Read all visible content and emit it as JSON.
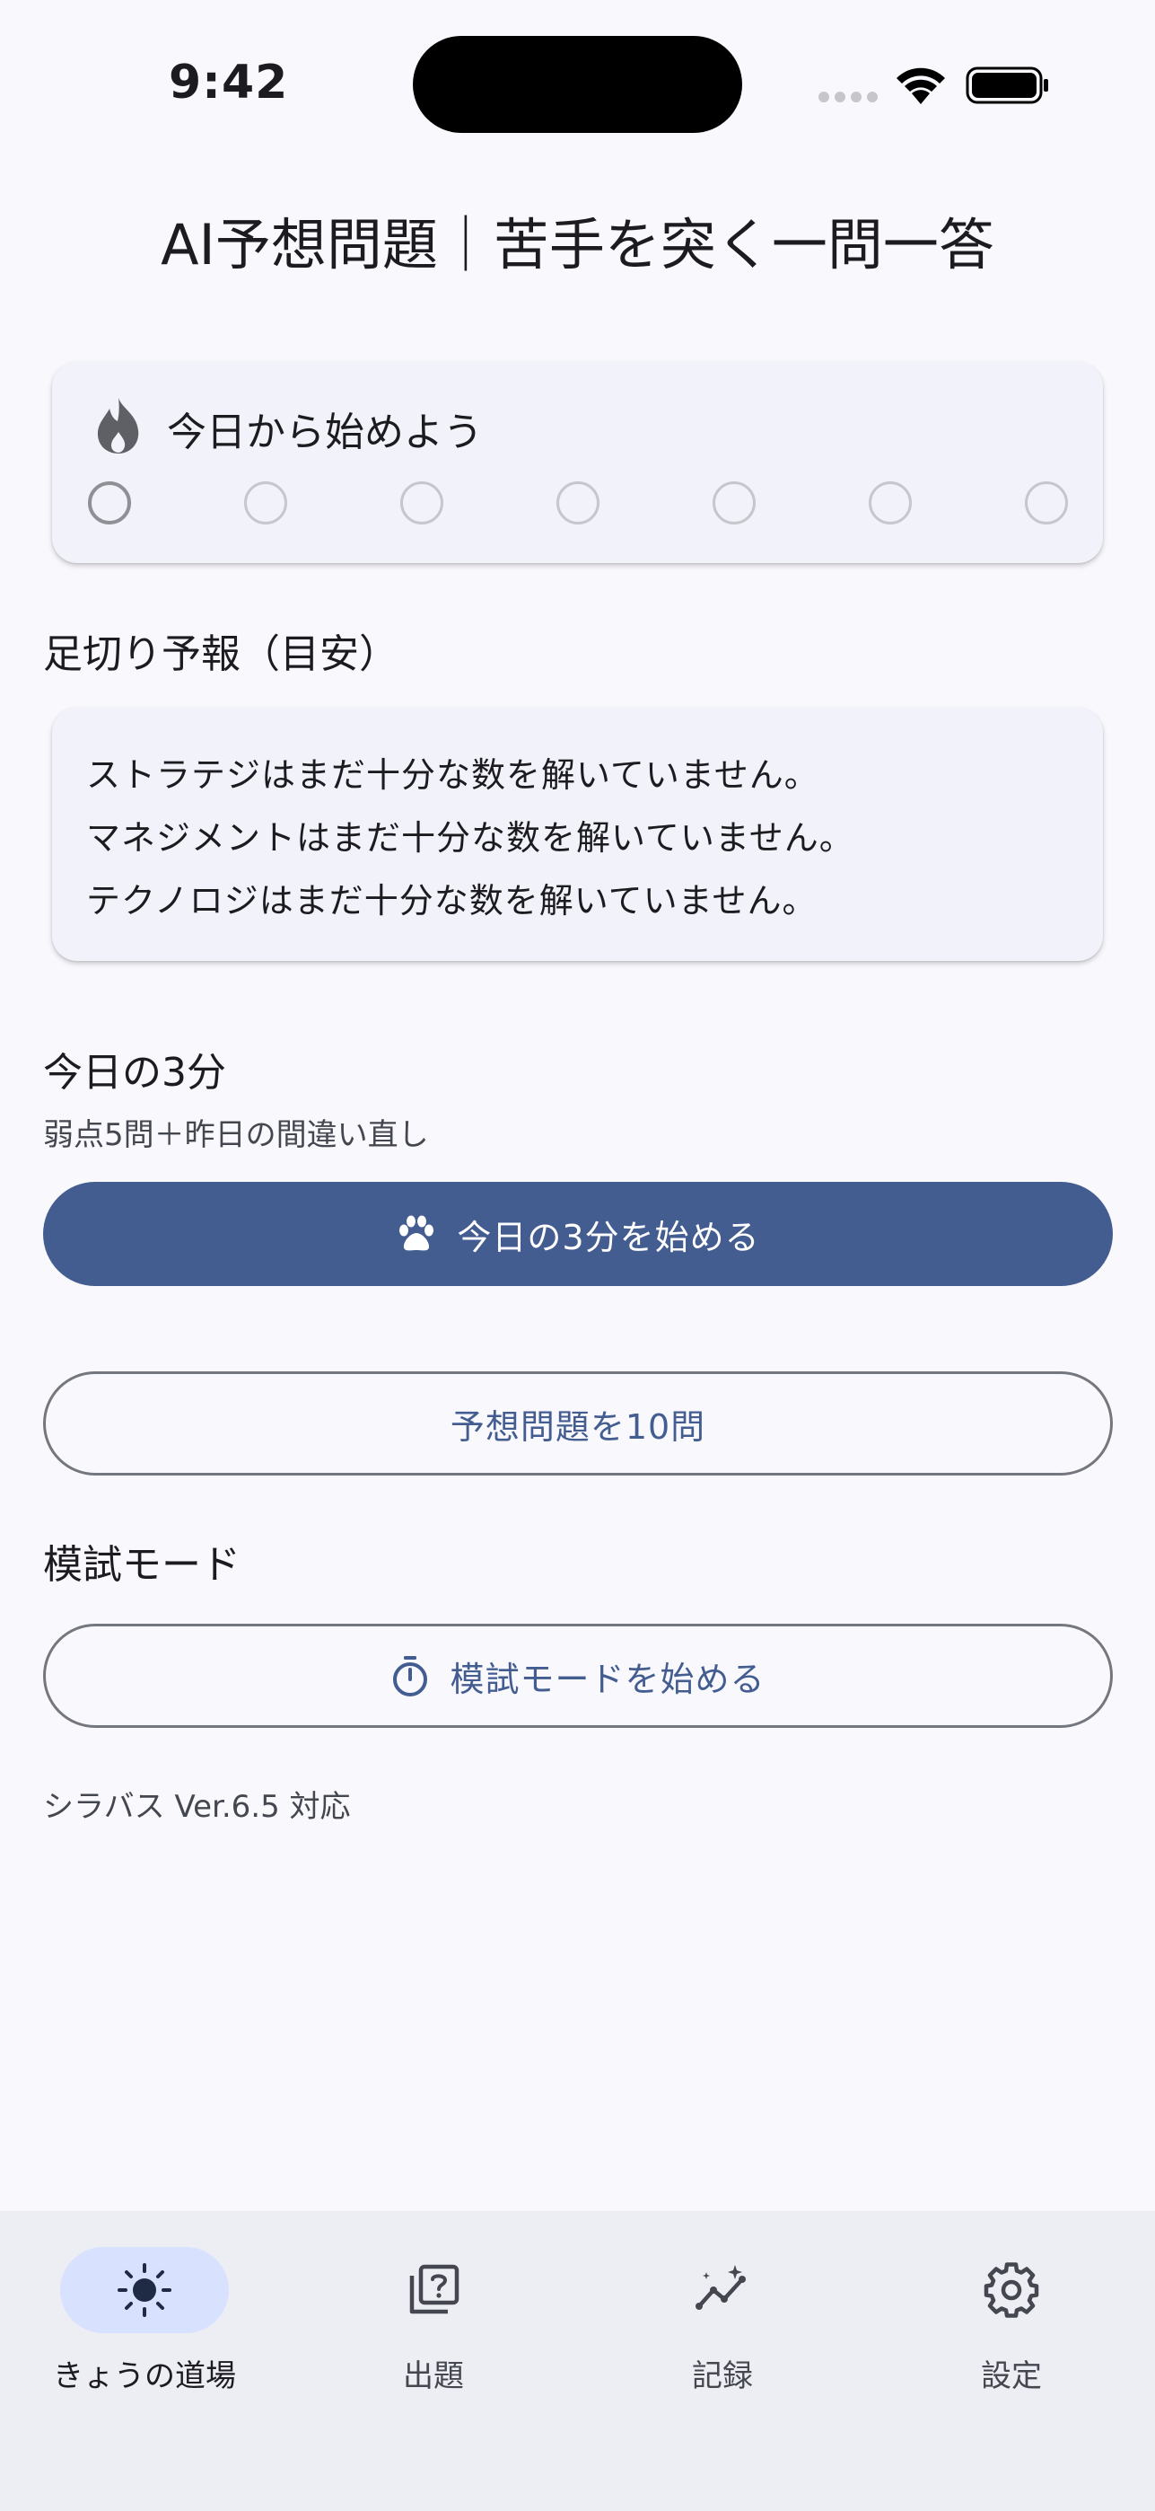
{
  "status_bar": {
    "time": "9:42"
  },
  "header": {
    "title": "AI予想問題｜苦手を突く一問一答"
  },
  "streak": {
    "title": "今日から始めよう",
    "days_completed": 0,
    "days_total": 7
  },
  "cutoff": {
    "title": "足切り予報（目安）",
    "lines": [
      "ストラテジはまだ十分な数を解いていません。",
      "マネジメントはまだ十分な数を解いていません。",
      "テクノロジはまだ十分な数を解いていません。"
    ]
  },
  "today": {
    "title": "今日の3分",
    "subtitle": "弱点5問＋昨日の間違い直し",
    "start_button": "今日の3分を始める",
    "predict_button": "予想問題を10問"
  },
  "mock": {
    "title": "模試モード",
    "start_button": "模試モードを始める"
  },
  "footer": {
    "syllabus": "シラバス Ver.6.5 対応"
  },
  "bottom_nav": {
    "items": [
      {
        "label": "きょうの道場",
        "icon": "sun-icon"
      },
      {
        "label": "出題",
        "icon": "quiz-icon"
      },
      {
        "label": "記録",
        "icon": "chart-icon"
      },
      {
        "label": "設定",
        "icon": "gear-icon"
      }
    ],
    "active": 0
  },
  "colors": {
    "primary": "#435d91",
    "active_pill": "#d8e2fe",
    "card": "#f2f3fa",
    "background": "#f9f8fd"
  }
}
